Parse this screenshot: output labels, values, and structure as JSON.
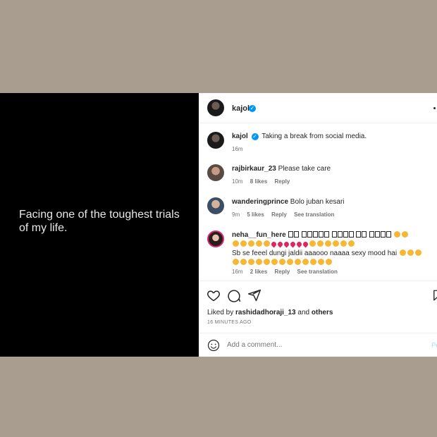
{
  "media": {
    "caption": "Facing one of the toughest trials of my life."
  },
  "header": {
    "username": "kajol",
    "verified_glyph": "✓",
    "more_icon": "more-horizontal-icon"
  },
  "post": {
    "username": "kajol",
    "verified_glyph": "✓",
    "text": "Taking a break from social media.",
    "age": "16m"
  },
  "comments": [
    {
      "username": "rajbirkaur_23",
      "text": "Please take care",
      "age": "10m",
      "likes": "8 likes",
      "reply": "Reply"
    },
    {
      "username": "wanderingprince",
      "text": "Bolo juban kesari",
      "age": "9m",
      "likes": "5 likes",
      "reply": "Reply",
      "translate": "See translation"
    },
    {
      "username": "neha__fun_here",
      "line2": "Sb se feeel dungi jaldii aaaooo naaaa sexy mood hai",
      "age": "16m",
      "likes": "2 likes",
      "reply": "Reply",
      "translate": "See translation"
    }
  ],
  "actions": {
    "like_icon": "heart-icon",
    "comment_icon": "comment-icon",
    "share_icon": "paper-plane-icon",
    "save_icon": "bookmark-icon"
  },
  "likes": {
    "prefix": "Liked by",
    "user": "rashidadhoraji_13",
    "and": "and",
    "others": "others"
  },
  "timestamp": "16 MINUTES AGO",
  "add_comment": {
    "placeholder": "Add a comment...",
    "post_label": "Post",
    "emoji_icon": "smiley-icon"
  },
  "colors": {
    "backdrop": "#a89d8f",
    "media_bg": "#000000",
    "verified": "#0095f6",
    "post_disabled": "#b2dffc"
  }
}
